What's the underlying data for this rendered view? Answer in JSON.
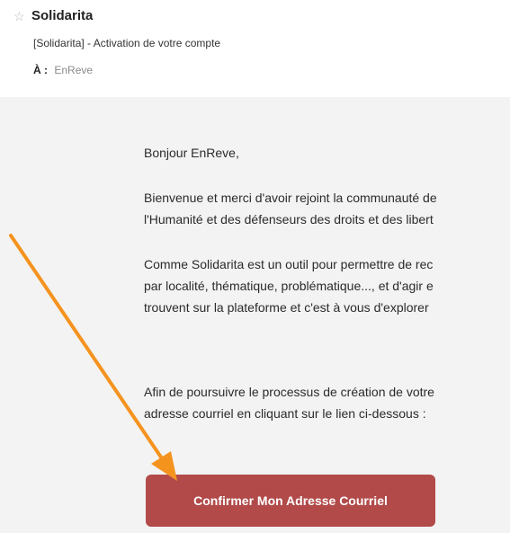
{
  "header": {
    "star_icon": "☆",
    "sender": "Solidarita",
    "subject": "[Solidarita] - Activation de votre compte",
    "to_label": "À :",
    "to_value": "EnReve"
  },
  "email": {
    "greeting": "Bonjour EnReve,",
    "paragraph1": [
      "Bienvenue et merci d'avoir rejoint la communauté de",
      "l'Humanité et des défenseurs des droits et des libert"
    ],
    "paragraph2": [
      "Comme Solidarita est un outil pour permettre de rec",
      "par localité, thématique, problématique..., et d'agir e",
      "trouvent sur la plateforme et c'est à vous d'explorer"
    ],
    "paragraph3": [
      "Afin de poursuivre le processus de création de votre",
      "adresse courriel en cliquant sur le lien ci-dessous :"
    ],
    "confirm_button": "Confirmer Mon Adresse Courriel"
  },
  "colors": {
    "button": "#b24a4a",
    "arrow": "#f5931f",
    "body_background": "#f3f3f3"
  }
}
